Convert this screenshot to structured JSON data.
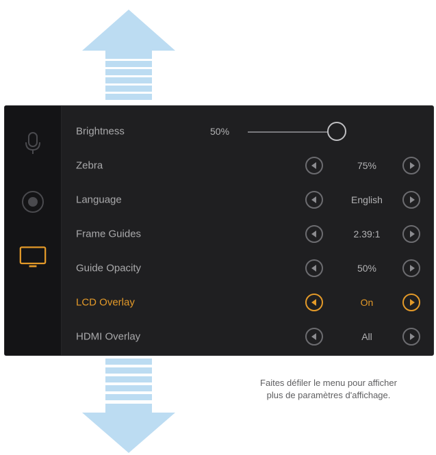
{
  "sidebar": {
    "icons": [
      "microphone-icon",
      "record-icon",
      "monitor-icon"
    ],
    "active_icon": "monitor-icon"
  },
  "settings": {
    "brightness": {
      "label": "Brightness",
      "value": "50%",
      "level": 0.5
    },
    "zebra": {
      "label": "Zebra",
      "value": "75%"
    },
    "language": {
      "label": "Language",
      "value": "English"
    },
    "frame_guides": {
      "label": "Frame Guides",
      "value": "2.39:1"
    },
    "guide_opacity": {
      "label": "Guide Opacity",
      "value": "50%"
    },
    "lcd_overlay": {
      "label": "LCD Overlay",
      "value": "On"
    },
    "hdmi_overlay": {
      "label": "HDMI Overlay",
      "value": "All"
    }
  },
  "caption": {
    "line1": "Faites défiler le menu pour afficher",
    "line2": "plus de paramètres d'affichage."
  },
  "colors": {
    "accent": "#e49a29",
    "panel": "#1f1f21",
    "arrow": "#bcdcf2"
  }
}
